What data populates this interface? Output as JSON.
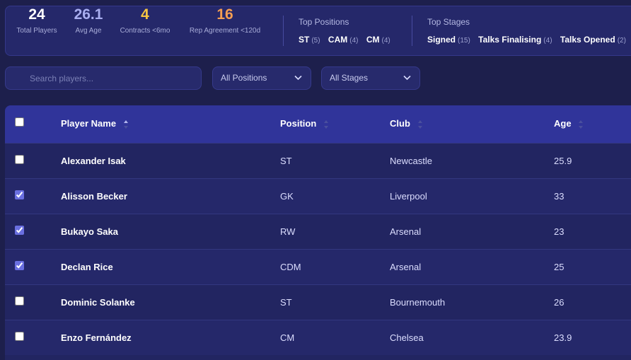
{
  "stats": [
    {
      "value": "24",
      "label": "Total Players",
      "color": "#ffffff"
    },
    {
      "value": "26.1",
      "label": "Avg Age",
      "color": "#a9aef0"
    },
    {
      "value": "4",
      "label": "Contracts <6mo",
      "color": "#f5c542"
    },
    {
      "value": "16",
      "label": "Rep Agreement <120d",
      "color": "#f59e52"
    }
  ],
  "top_positions": {
    "title": "Top Positions",
    "items": [
      {
        "name": "ST",
        "count": "(5)"
      },
      {
        "name": "CAM",
        "count": "(4)"
      },
      {
        "name": "CM",
        "count": "(4)"
      }
    ]
  },
  "top_stages": {
    "title": "Top Stages",
    "items": [
      {
        "name": "Signed",
        "count": "(15)"
      },
      {
        "name": "Talks Finalising",
        "count": "(4)"
      },
      {
        "name": "Talks Opened",
        "count": "(2)"
      }
    ]
  },
  "filters": {
    "search_placeholder": "Search players...",
    "positions": "All Positions",
    "stages": "All Stages"
  },
  "table": {
    "headers": {
      "name": "Player Name",
      "position": "Position",
      "club": "Club",
      "age": "Age"
    },
    "rows": [
      {
        "name": "Alexander Isak",
        "position": "ST",
        "club": "Newcastle",
        "age": "25.9",
        "checked": false
      },
      {
        "name": "Alisson Becker",
        "position": "GK",
        "club": "Liverpool",
        "age": "33",
        "checked": true
      },
      {
        "name": "Bukayo Saka",
        "position": "RW",
        "club": "Arsenal",
        "age": "23",
        "checked": true
      },
      {
        "name": "Declan Rice",
        "position": "CDM",
        "club": "Arsenal",
        "age": "25",
        "checked": true
      },
      {
        "name": "Dominic Solanke",
        "position": "ST",
        "club": "Bournemouth",
        "age": "26",
        "checked": false
      },
      {
        "name": "Enzo Fernández",
        "position": "CM",
        "club": "Chelsea",
        "age": "23.9",
        "checked": false
      }
    ]
  }
}
